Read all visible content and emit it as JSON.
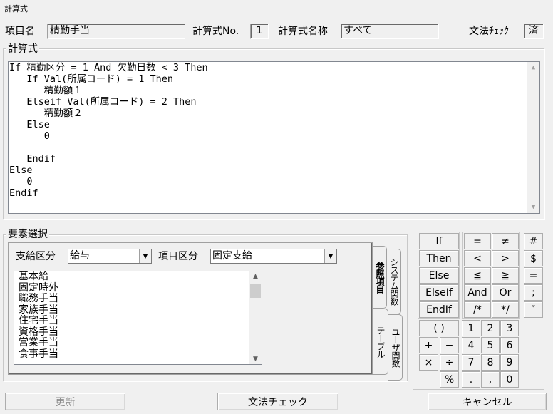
{
  "window": {
    "title": "計算式"
  },
  "header": {
    "item_name_label": "項目名",
    "item_name_value": "精勤手当",
    "formula_no_label": "計算式No.",
    "formula_no_value": "1",
    "formula_name_label": "計算式名称",
    "formula_name_value": "すべて",
    "syntax_check_label": "文法ﾁｪｯｸ",
    "syntax_check_value": "済"
  },
  "formula": {
    "group_title": "計算式",
    "code": "If 精勤区分 = 1 And 欠勤日数 < 3 Then\n   If Val(所属コード) = 1 Then\n      精勤額１\n   Elseif Val(所属コード) = 2 Then\n      精勤額２\n   Else\n      0\n\n   Endif\nElse\n   0\nEndif"
  },
  "elements": {
    "group_title": "要素選択",
    "pay_type_label": "支給区分",
    "pay_type_value": "給与",
    "item_type_label": "項目区分",
    "item_type_value": "固定支給",
    "items": [
      "基本給",
      "固定時外",
      "職務手当",
      "家族手当",
      "住宅手当",
      "資格手当",
      "営業手当",
      "食事手当"
    ],
    "tabs": {
      "reference_items": "参照項目",
      "system_functions": "システム関数",
      "table": "テーブル",
      "user_functions": "ユーザ関数"
    }
  },
  "keypad": {
    "keywords": [
      "If",
      "Then",
      "Else",
      "ElseIf",
      "EndIf"
    ],
    "ops": [
      "=",
      "≠",
      "<",
      ">",
      "≦",
      "≧",
      "And",
      "Or",
      "/*",
      "*/"
    ],
    "symbols": [
      "#",
      "$",
      "=",
      ";",
      "″"
    ],
    "paren": "( )",
    "arith": [
      "+",
      "−",
      "×",
      "÷",
      "%"
    ],
    "digits": [
      "1",
      "2",
      "3",
      "4",
      "5",
      "6",
      "7",
      "8",
      "9",
      ".",
      ",",
      "0"
    ]
  },
  "buttons": {
    "update": "更新",
    "syntax_check": "文法チェック",
    "cancel": "キャンセル"
  }
}
